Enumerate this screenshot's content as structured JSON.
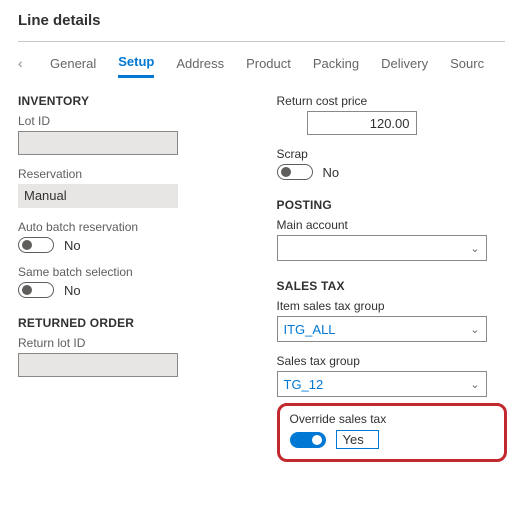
{
  "header": "Line details",
  "tabs": {
    "items": [
      "General",
      "Setup",
      "Address",
      "Product",
      "Packing",
      "Delivery",
      "Sourc"
    ],
    "active": "Setup"
  },
  "inventory": {
    "heading": "INVENTORY",
    "lot_id_label": "Lot ID",
    "lot_id_value": "",
    "reservation_label": "Reservation",
    "reservation_value": "Manual",
    "auto_batch_label": "Auto batch reservation",
    "auto_batch_value": "No",
    "same_batch_label": "Same batch selection",
    "same_batch_value": "No"
  },
  "returned": {
    "heading": "RETURNED ORDER",
    "return_lot_label": "Return lot ID",
    "return_lot_value": "",
    "return_cost_label": "Return cost price",
    "return_cost_value": "120.00",
    "scrap_label": "Scrap",
    "scrap_value": "No"
  },
  "posting": {
    "heading": "POSTING",
    "main_account_label": "Main account",
    "main_account_value": ""
  },
  "sales_tax": {
    "heading": "SALES TAX",
    "item_group_label": "Item sales tax group",
    "item_group_value": "ITG_ALL",
    "tax_group_label": "Sales tax group",
    "tax_group_value": "TG_12",
    "override_label": "Override sales tax",
    "override_value": "Yes"
  }
}
